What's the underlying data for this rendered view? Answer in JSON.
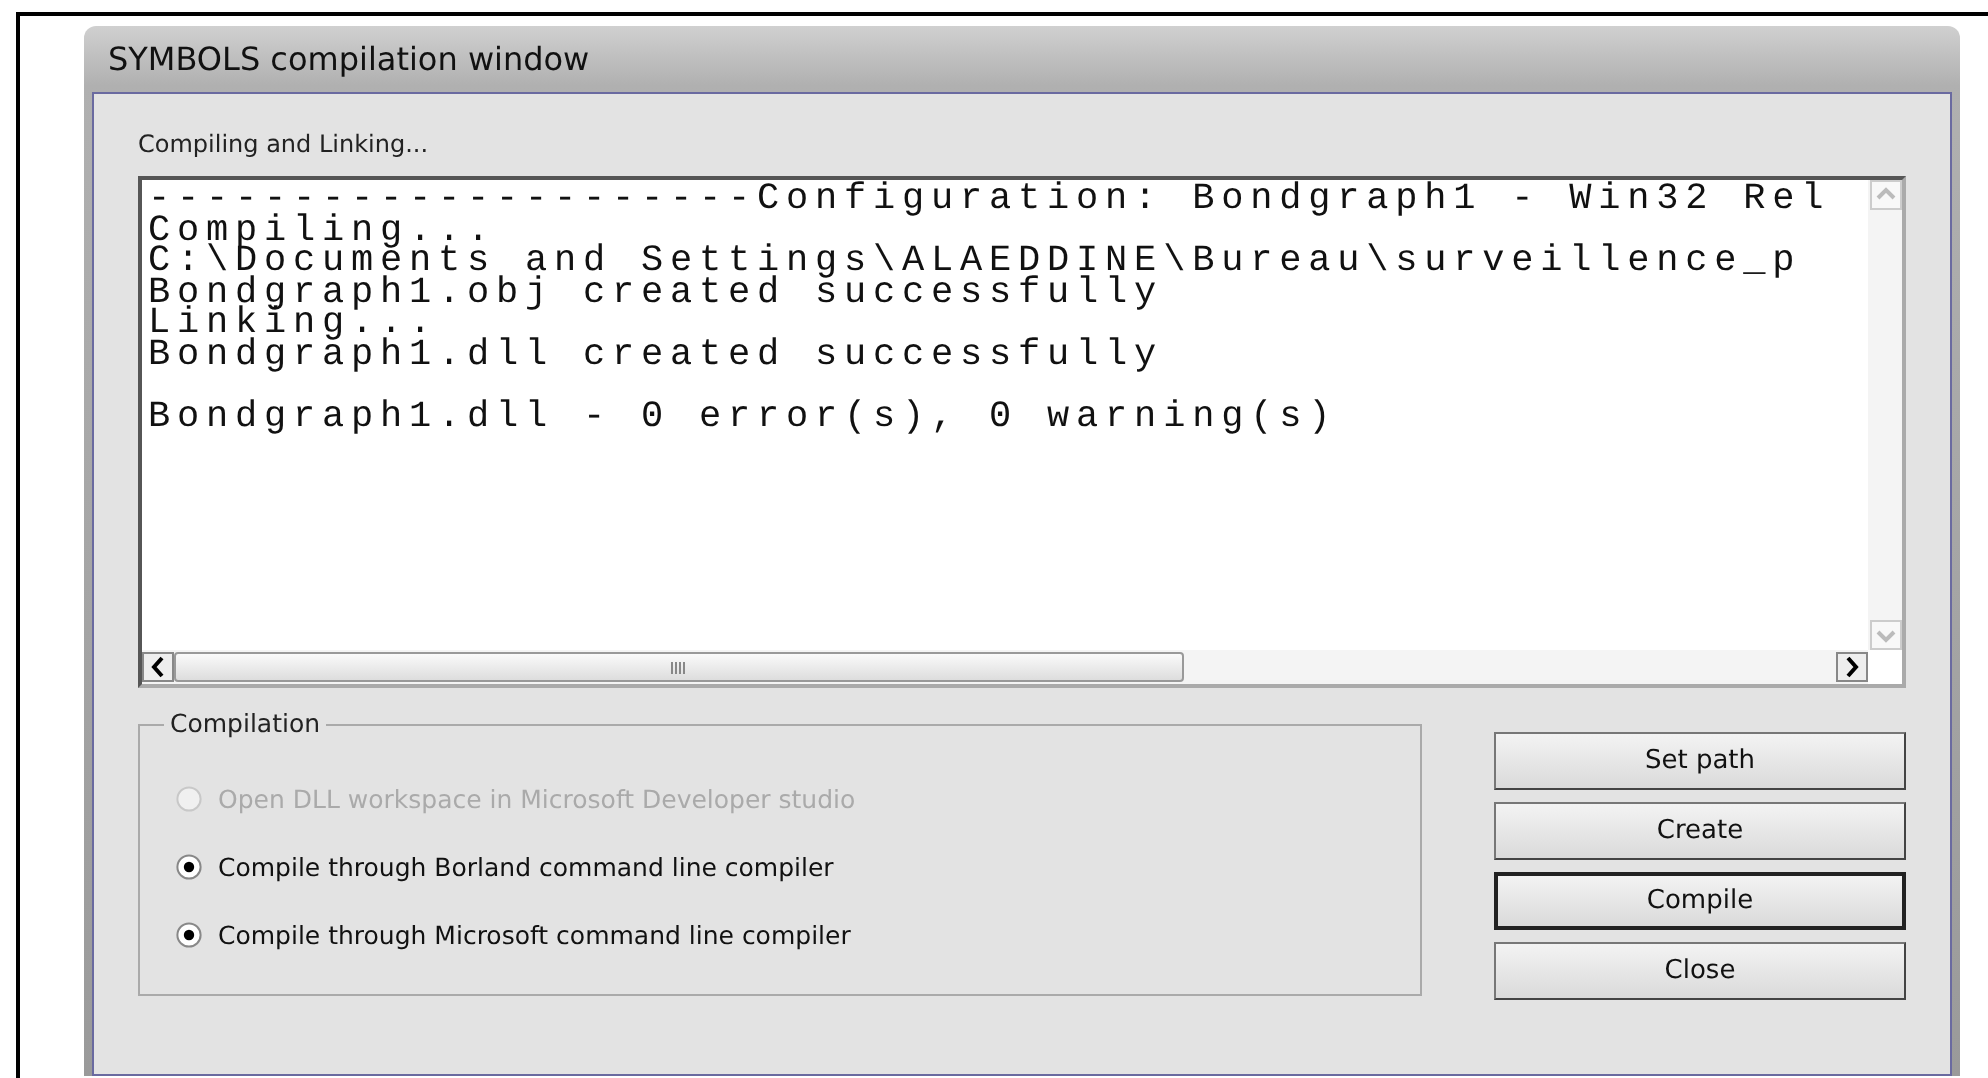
{
  "window": {
    "title": "SYMBOLS compilation window"
  },
  "status_label": "Compiling and Linking...",
  "log": {
    "lines": [
      {
        "text": "---------------------Configuration: Bondgraph1 - Win32 Rel",
        "gap_before": false
      },
      {
        "text": "Compiling...",
        "gap_before": false
      },
      {
        "text": "C:\\Documents and Settings\\ALAEDDINE\\Bureau\\surveillence_p",
        "gap_before": false
      },
      {
        "text": "Bondgraph1.obj created successfully",
        "gap_before": false
      },
      {
        "text": "Linking...",
        "gap_before": false
      },
      {
        "text": "Bondgraph1.dll created successfully",
        "gap_before": false
      },
      {
        "text": "Bondgraph1.dll - 0 error(s), 0 warning(s)",
        "gap_before": true
      }
    ]
  },
  "compilation": {
    "title": "Compilation",
    "options": [
      {
        "label": "Open DLL workspace in Microsoft Developer studio",
        "selected": false,
        "disabled": true
      },
      {
        "label": "Compile through Borland command line compiler",
        "selected": true,
        "disabled": false
      },
      {
        "label": "Compile through Microsoft command line compiler",
        "selected": true,
        "disabled": false
      }
    ]
  },
  "buttons": [
    {
      "label": "Set path",
      "default": false
    },
    {
      "label": "Create",
      "default": false
    },
    {
      "label": "Compile",
      "default": true
    },
    {
      "label": "Close",
      "default": false
    }
  ]
}
